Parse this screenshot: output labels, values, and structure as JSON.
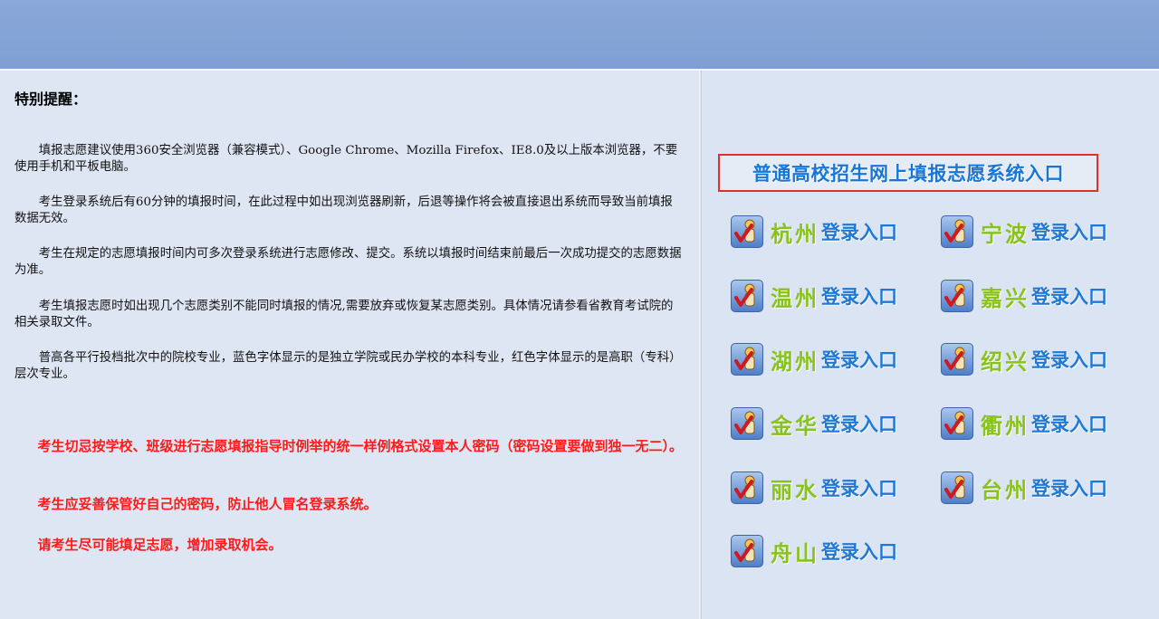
{
  "notice": {
    "title": "特别提醒：",
    "paragraphs": [
      "填报志愿建议使用360安全浏览器（兼容模式）、Google Chrome、Mozilla Firefox、IE8.0及以上版本浏览器，不要使用手机和平板电脑。",
      "考生登录系统后有60分钟的填报时间，在此过程中如出现浏览器刷新，后退等操作将会被直接退出系统而导致当前填报数据无效。",
      "考生在规定的志愿填报时间内可多次登录系统进行志愿修改、提交。系统以填报时间结束前最后一次成功提交的志愿数据为准。",
      "考生填报志愿时如出现几个志愿类别不能同时填报的情况,需要放弃或恢复某志愿类别。具体情况请参看省教育考试院的相关录取文件。",
      "普高各平行投档批次中的院校专业，蓝色字体显示的是独立学院或民办学校的本科专业，红色字体显示的是高职（专科）层次专业。"
    ],
    "warnings": [
      "考生切忌按学校、班级进行志愿填报指导时例举的统一样例格式设置本人密码（密码设置要做到独一无二）。",
      "考生应妥善保管好自己的密码，防止他人冒名登录系统。",
      "请考生尽可能填足志愿，增加录取机会。"
    ]
  },
  "system_entry": {
    "label": "普通高校招生网上填报志愿系统入口"
  },
  "login_suffix": "登录入口",
  "cities": [
    {
      "name": "杭州",
      "login": "登录入口"
    },
    {
      "name": "宁波",
      "login": "登录入口"
    },
    {
      "name": "温州",
      "login": "登录入口"
    },
    {
      "name": "嘉兴",
      "login": "登录入口"
    },
    {
      "name": "湖州",
      "login": "登录入口"
    },
    {
      "name": "绍兴",
      "login": "登录入口"
    },
    {
      "name": "金华",
      "login": "登录入口"
    },
    {
      "name": "衢州",
      "login": "登录入口"
    },
    {
      "name": "丽水",
      "login": "登录入口"
    },
    {
      "name": "台州",
      "login": "登录入口"
    },
    {
      "name": "舟山",
      "login": "登录入口"
    }
  ],
  "icon": "user-check-icon",
  "colors": {
    "header": "#7f9fd4",
    "warning_text": "#ff1a1a",
    "city_name": "#88c21c",
    "login_text": "#1f78d4",
    "entry_border": "#e0302c"
  }
}
